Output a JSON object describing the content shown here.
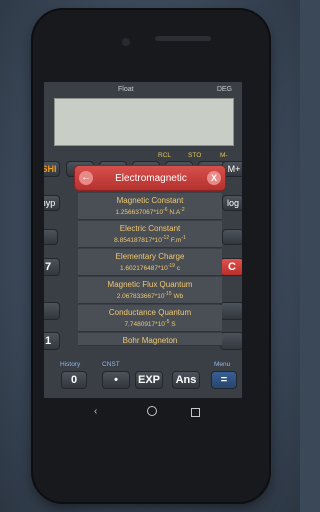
{
  "status": {
    "mode": "Float",
    "angle": "DEG"
  },
  "labels": {
    "rcl": "RCL",
    "sto": "STO",
    "mminus": "M-"
  },
  "keys": {
    "shift": "SHI",
    "mplus": "M+",
    "hyp": "hyp",
    "log": "log",
    "seven": "7",
    "c": "C",
    "one": "1",
    "zero": "0",
    "dot": "•",
    "exp": "EXP",
    "ans": "Ans",
    "equals": "="
  },
  "bottom_labels": {
    "history": "History",
    "cnst": "CNST",
    "menu": "Menu"
  },
  "dialog": {
    "title": "Electromagnetic",
    "items": [
      {
        "name": "Magnetic Constant",
        "value": "1.256637067*10",
        "exp": "-6",
        "unit": "N.A",
        "unit_exp": "-2"
      },
      {
        "name": "Electric Constant",
        "value": "8.854187817*10",
        "exp": "-12",
        "unit": "F.m",
        "unit_exp": "-1"
      },
      {
        "name": "Elementary Charge",
        "value": "1.602176487*10",
        "exp": "-19",
        "unit": "c",
        "unit_exp": ""
      },
      {
        "name": "Magnetic Flux Quantum",
        "value": "2.067833667*10",
        "exp": "-15",
        "unit": "Wb",
        "unit_exp": ""
      },
      {
        "name": "Conductance Quantum",
        "value": "7.7480917*10",
        "exp": "-5",
        "unit": "S",
        "unit_exp": ""
      },
      {
        "name": "Bohr Magneton",
        "value": "",
        "exp": "",
        "unit": "",
        "unit_exp": ""
      }
    ]
  }
}
